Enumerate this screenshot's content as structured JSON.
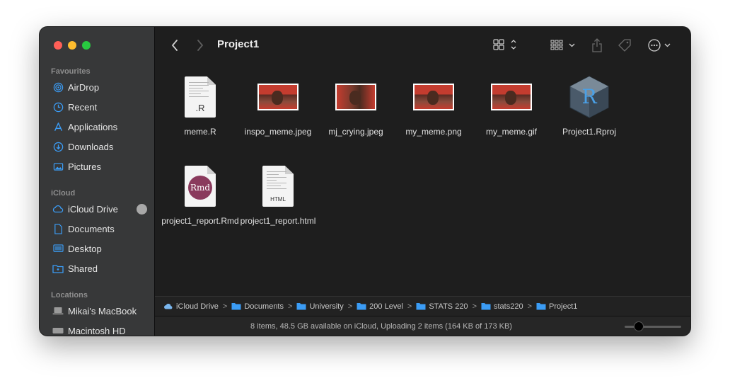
{
  "window": {
    "title": "Project1"
  },
  "sidebar": {
    "sections": [
      {
        "label": "Favourites",
        "items": [
          {
            "label": "AirDrop",
            "icon": "airdrop-icon"
          },
          {
            "label": "Recent",
            "icon": "clock-icon"
          },
          {
            "label": "Applications",
            "icon": "applications-icon"
          },
          {
            "label": "Downloads",
            "icon": "download-icon"
          },
          {
            "label": "Pictures",
            "icon": "pictures-icon"
          }
        ]
      },
      {
        "label": "iCloud",
        "items": [
          {
            "label": "iCloud Drive",
            "icon": "cloud-icon"
          },
          {
            "label": "Documents",
            "icon": "document-icon"
          },
          {
            "label": "Desktop",
            "icon": "desktop-icon"
          },
          {
            "label": "Shared",
            "icon": "shared-folder-icon"
          }
        ]
      },
      {
        "label": "Locations",
        "items": [
          {
            "label": "Mikai's MacBook",
            "icon": "laptop-icon"
          },
          {
            "label": "Macintosh HD",
            "icon": "disk-icon"
          }
        ]
      }
    ]
  },
  "files": [
    {
      "name": "meme.R",
      "kind": "r-script",
      "tag": ".R"
    },
    {
      "name": "inspo_meme.jpeg",
      "kind": "image"
    },
    {
      "name": "mj_crying.jpeg",
      "kind": "image"
    },
    {
      "name": "my_meme.png",
      "kind": "image"
    },
    {
      "name": "my_meme.gif",
      "kind": "image"
    },
    {
      "name": "Project1.Rproj",
      "kind": "rproj",
      "tag": "R"
    },
    {
      "name": "project1_report.Rmd",
      "kind": "rmd",
      "tag": "Rmd"
    },
    {
      "name": "project1_report.html",
      "kind": "html",
      "tag": "HTML"
    }
  ],
  "pathbar": [
    {
      "label": "iCloud Drive",
      "icon": "cloud-icon"
    },
    {
      "label": "Documents",
      "icon": "folder-icon"
    },
    {
      "label": "University",
      "icon": "folder-icon"
    },
    {
      "label": "200 Level",
      "icon": "folder-icon"
    },
    {
      "label": "STATS 220",
      "icon": "folder-icon"
    },
    {
      "label": "stats220",
      "icon": "folder-icon"
    },
    {
      "label": "Project1",
      "icon": "folder-icon"
    }
  ],
  "pathbar_separator": ">",
  "status": {
    "text": "8 items, 48.5 GB available on iCloud, Uploading 2 items (164 KB of 173 KB)"
  },
  "colors": {
    "accent": "#3b9cf5",
    "sidebar_bg": "#373839",
    "main_bg": "#1e1e1e"
  }
}
